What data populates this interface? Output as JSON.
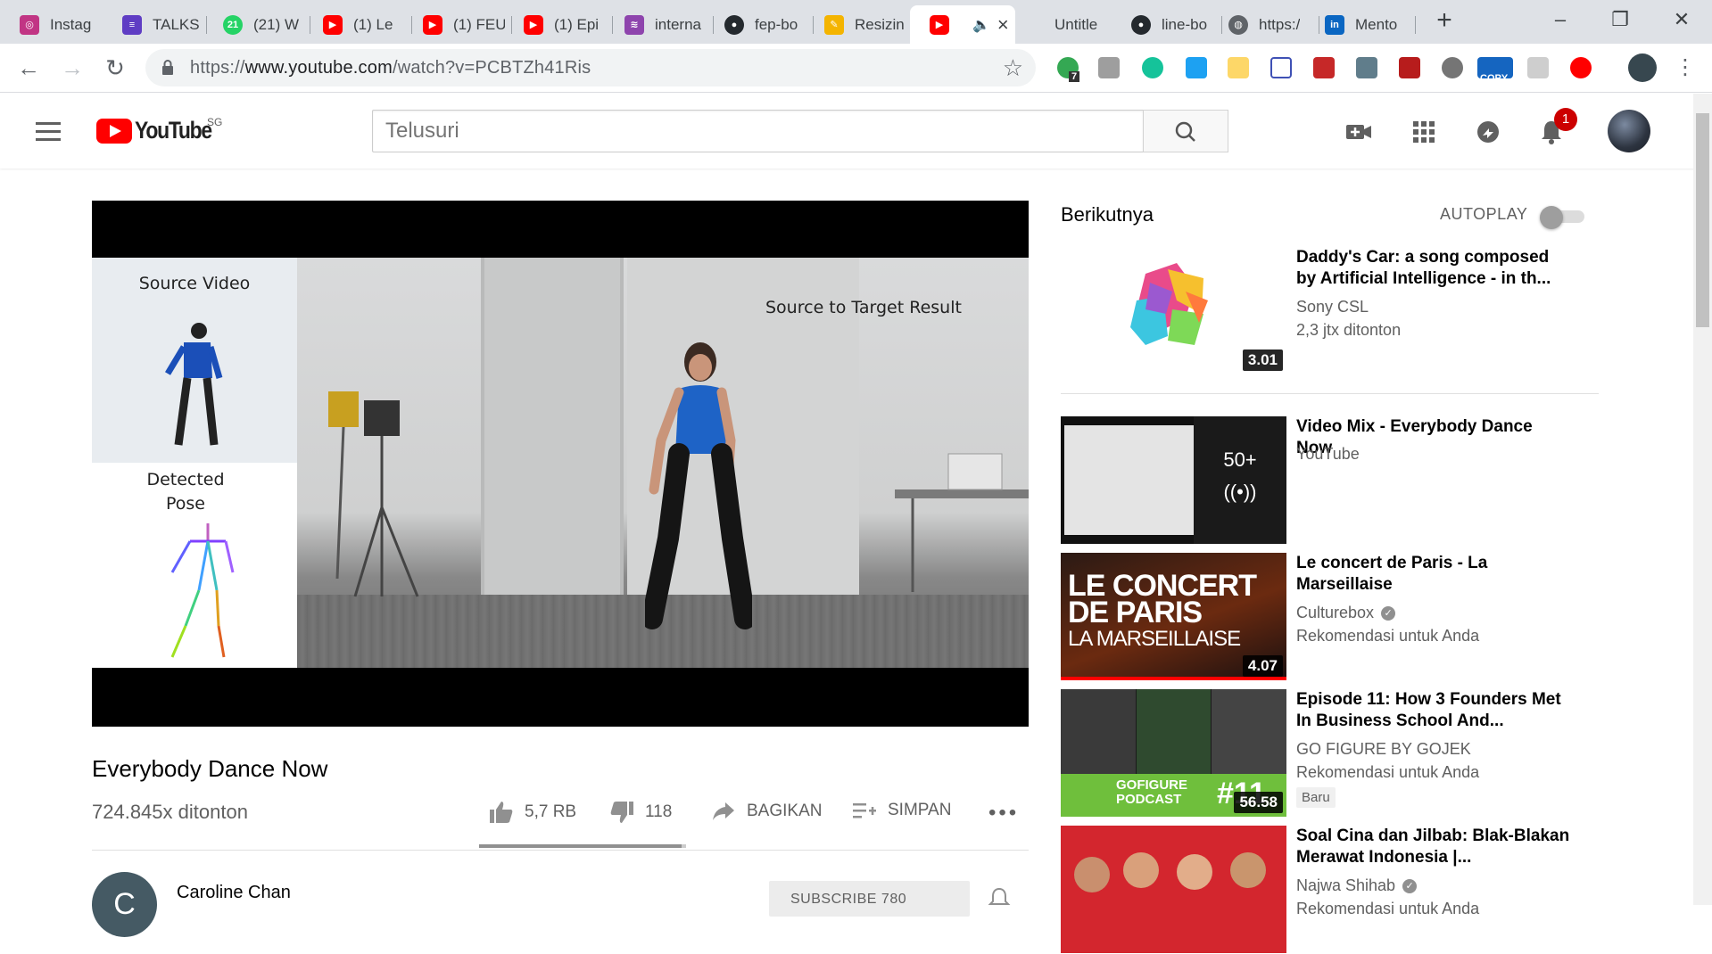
{
  "browser": {
    "tabs": [
      {
        "title": "Instag",
        "favicon": "instagram-icon",
        "color": "#c13584"
      },
      {
        "title": "TALKS",
        "favicon": "list-icon",
        "color": "#5f3dc4"
      },
      {
        "title": "(21) W",
        "favicon": "whatsapp-icon",
        "color": "#25d366"
      },
      {
        "title": "(1) Le",
        "favicon": "youtube-icon",
        "color": "#ff0000"
      },
      {
        "title": "(1) FEU",
        "favicon": "youtube-icon",
        "color": "#ff0000"
      },
      {
        "title": "(1) Epi",
        "favicon": "youtube-icon",
        "color": "#ff0000"
      },
      {
        "title": "interna",
        "favicon": "layers-icon",
        "color": "#8e44ad"
      },
      {
        "title": "fep-bo",
        "favicon": "github-icon",
        "color": "#24292e"
      },
      {
        "title": "Resizin",
        "favicon": "pencil-icon",
        "color": "#f4b400"
      },
      {
        "title": "",
        "favicon": "youtube-icon",
        "color": "#ff0000",
        "active": true
      },
      {
        "title": "Untitle",
        "favicon": "blank-icon",
        "color": "#ffffff"
      },
      {
        "title": "line-bo",
        "favicon": "github-icon",
        "color": "#24292e"
      },
      {
        "title": "https:/",
        "favicon": "globe-icon",
        "color": "#5f6368"
      },
      {
        "title": "Mento",
        "favicon": "linkedin-icon",
        "color": "#0a66c2"
      }
    ],
    "new_tab": "+",
    "url_prefix": "https://",
    "url_host": "www.youtube.com",
    "url_path": "/watch?v=PCBTZh41Ris",
    "ext_badge_count": "7",
    "ext_copy_label": "COPY"
  },
  "youtube": {
    "country_code": "SG",
    "logo_text": "YouTube",
    "search_placeholder": "Telusuri",
    "notification_count": "1"
  },
  "player": {
    "inset_source_label": "Source Video",
    "inset_pose_label_1": "Detected",
    "inset_pose_label_2": "Pose",
    "result_label": "Source to Target Result"
  },
  "video": {
    "title": "Everybody Dance Now",
    "views": "724.845x ditonton",
    "likes": "5,7 RB",
    "dislikes": "118",
    "share_label": "BAGIKAN",
    "save_label": "SIMPAN",
    "like_ratio": 0.98,
    "channel_initial": "C",
    "channel_name": "Caroline Chan",
    "subscribe_label": "SUBSCRIBE 780"
  },
  "sidebar": {
    "up_next_label": "Berikutnya",
    "autoplay_label": "AUTOPLAY",
    "up_next": {
      "title": "Daddy's Car: a song composed by Artificial Intelligence - in th...",
      "channel": "Sony CSL",
      "meta": "2,3 jtx ditonton",
      "duration": "3.01"
    },
    "recommendations": [
      {
        "title": "Video Mix - Everybody Dance Now",
        "channel": "YouTube",
        "meta": "",
        "duration": "",
        "mix_count": "50+",
        "verified": false,
        "badge": ""
      },
      {
        "title": "Le concert de Paris - La Marseillaise",
        "channel": "Culturebox",
        "meta": "Rekomendasi untuk Anda",
        "duration": "4.07",
        "verified": true,
        "badge": "",
        "thumb_text_1": "LE CONCERT",
        "thumb_text_2": "DE PARIS",
        "thumb_text_3": "LA MARSEILLAISE"
      },
      {
        "title": "Episode 11: How 3 Founders Met In Business School And...",
        "channel": "GO FIGURE BY GOJEK",
        "meta": "Rekomendasi untuk Anda",
        "duration": "56.58",
        "verified": false,
        "badge": "Baru",
        "thumb_text_1": "GOFIGURE",
        "thumb_text_2": "PODCAST",
        "thumb_text_3": "#11"
      },
      {
        "title": "Soal Cina dan Jilbab: Blak-Blakan Merawat Indonesia |...",
        "channel": "Najwa Shihab",
        "meta": "Rekomendasi untuk Anda",
        "duration": "",
        "verified": true,
        "badge": ""
      }
    ]
  }
}
